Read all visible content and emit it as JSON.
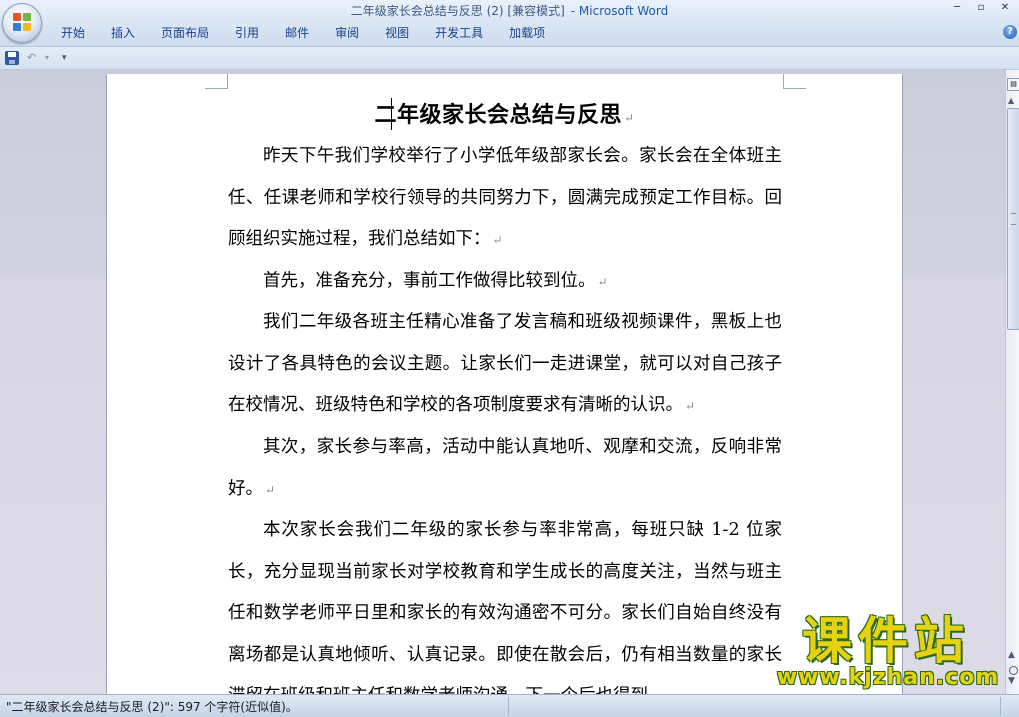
{
  "window": {
    "title": "二年级家长会总结与反思 (2) [兼容模式]",
    "app_name": "- Microsoft Word",
    "controls": [
      "─",
      "▫",
      "✕"
    ]
  },
  "ribbon": {
    "tabs": [
      "开始",
      "插入",
      "页面布局",
      "引用",
      "邮件",
      "审阅",
      "视图",
      "开发工具",
      "加载项"
    ]
  },
  "quick_access": {
    "icons": [
      "save-icon",
      "undo-icon",
      "customize-icon"
    ],
    "undo_glyph": "↶",
    "dropdown_glyph": "▾"
  },
  "document": {
    "title": "二年级家长会总结与反思",
    "paragraph_mark": "↵",
    "paragraphs": [
      "昨天下午我们学校举行了小学低年级部家长会。家长会在全体班主任、任课老师和学校行领导的共同努力下，圆满完成预定工作目标。回顾组织实施过程，我们总结如下：",
      "首先，准备充分，事前工作做得比较到位。",
      "我们二年级各班主任精心准备了发言稿和班级视频课件，黑板上也设计了各具特色的会议主题。让家长们一走进课堂，就可以对自己孩子在校情况、班级特色和学校的各项制度要求有清晰的认识。",
      "其次，家长参与率高，活动中能认真地听、观摩和交流，反响非常好。",
      "本次家长会我们二年级的家长参与率非常高，每班只缺 1-2 位家长，充分显现当前家长对学校教育和学生成长的高度关注，当然与班主任和数学老师平日里和家长的有效沟通密不可分。家长们自始自终没有离场都是认真地倾听、认真记录。即使在散会后，仍有相当数量的家长滞留在班级和班主任和数学老师沟通。下一个后也得到"
    ]
  },
  "status_bar": {
    "text": "\"二年级家长会总结与反思 (2)\": 597 个字符(近似值)。"
  },
  "watermark": {
    "text": "课件站",
    "url": "www.kjzhan.com"
  },
  "colors": {
    "title_text": "#3e5a86",
    "app_name": "#1e5aa8",
    "tab_text": "#15428b",
    "watermark_fill": "#e6d214",
    "watermark_outline": "#2a6a14"
  }
}
